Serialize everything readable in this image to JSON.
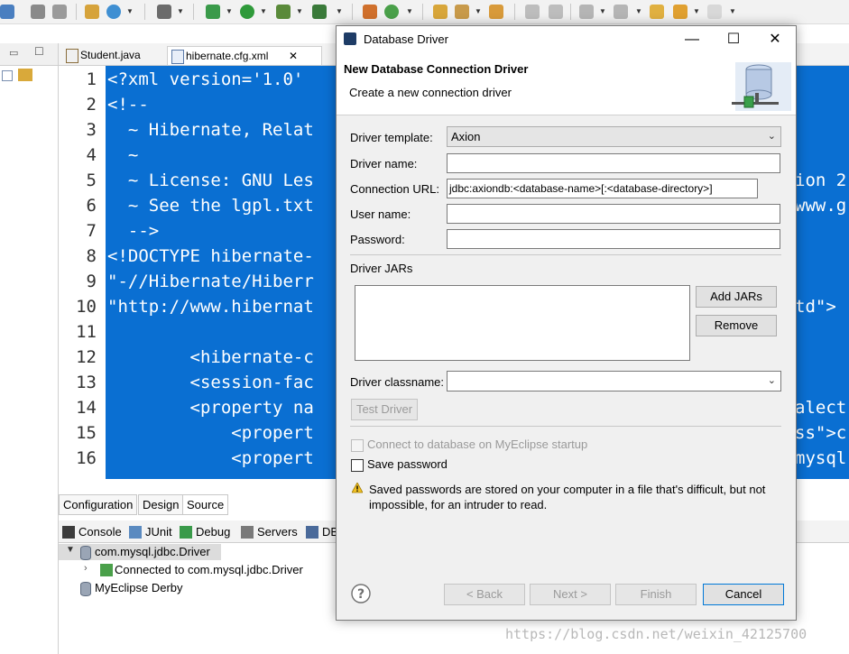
{
  "colors": {
    "editor_selection": "#0a6fd2",
    "accent": "#0078d7"
  },
  "editor": {
    "tabs": [
      {
        "label": "Student.java",
        "icon": "java-file-icon"
      },
      {
        "label": "hibernate.cfg.xml",
        "icon": "xml-file-icon"
      }
    ],
    "line_numbers": [
      "1",
      "2",
      "3",
      "4",
      "5",
      "6",
      "7",
      "8",
      "9",
      "10",
      "11",
      "12",
      "13",
      "14",
      "15",
      "16"
    ],
    "lines": [
      "<?xml version='1.0'",
      "<!--",
      "  ~ Hibernate, Relat",
      "  ~",
      "  ~ License: GNU Les",
      "  ~ See the lgpl.txt",
      "  -->",
      "<!DOCTYPE hibernate-",
      "\"-//Hibernate/Hiberr",
      "\"http://www.hibernat",
      "",
      "        <hibernate-c",
      "        <session-fac",
      "        <property na",
      "            <propert",
      "            <propert"
    ],
    "right_fragments": [
      {
        "line": 5,
        "text": "ion 2"
      },
      {
        "line": 6,
        "text": "www.g"
      },
      {
        "line": 10,
        "text": "td\">"
      },
      {
        "line": 14,
        "text": "alect"
      },
      {
        "line": 15,
        "text": "ss\">c"
      },
      {
        "line": 16,
        "text": "mysql"
      }
    ],
    "source_tabs": [
      "Configuration",
      "Design",
      "Source"
    ]
  },
  "console": {
    "tabs": [
      "Console",
      "JUnit",
      "Debug",
      "Servers",
      "DB"
    ],
    "tree": [
      {
        "label": "com.mysql.jdbc.Driver",
        "level": 0,
        "expanded": true
      },
      {
        "label": "Connected to com.mysql.jdbc.Driver",
        "level": 1,
        "expanded": false
      },
      {
        "label": "MyEclipse Derby",
        "level": 0
      }
    ]
  },
  "dialog": {
    "title": "Database Driver",
    "banner_title": "New Database Connection Driver",
    "banner_subtitle": "Create a new connection driver",
    "driver_template_label": "Driver template:",
    "driver_template_value": "Axion",
    "driver_name_label": "Driver name:",
    "driver_name_value": "",
    "connection_url_label": "Connection URL:",
    "connection_url_value": "jdbc:axiondb:<database-name>[:<database-directory>]",
    "user_name_label": "User name:",
    "user_name_value": "",
    "password_label": "Password:",
    "password_value": "",
    "driver_jars_label": "Driver JARs",
    "add_jars_label": "Add JARs",
    "remove_label": "Remove",
    "driver_classname_label": "Driver classname:",
    "driver_classname_value": "",
    "test_driver_label": "Test Driver",
    "connect_startup_label": "Connect to database on MyEclipse startup",
    "save_password_label": "Save password",
    "warning_text": "Saved passwords are stored on your computer in a file that's difficult, but not impossible, for an intruder to read.",
    "back_label": "< Back",
    "next_label": "Next >",
    "finish_label": "Finish",
    "cancel_label": "Cancel",
    "help_icon": "help-icon"
  },
  "watermark": "https://blog.csdn.net/weixin_42125700"
}
